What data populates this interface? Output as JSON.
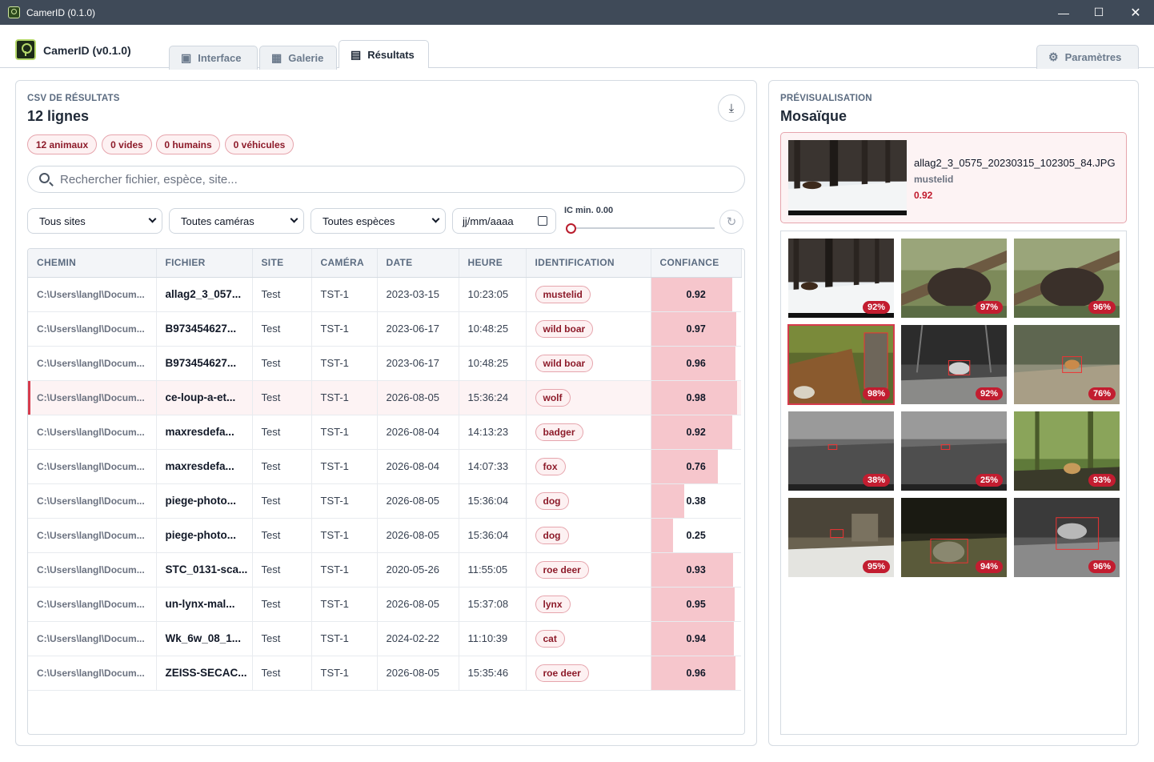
{
  "window": {
    "title": "CamerID (0.1.0)",
    "controls": [
      "minimize",
      "maximize",
      "close"
    ]
  },
  "header": {
    "brand": "CamerID (v0.1.0)",
    "tabs": [
      {
        "label": "Interface",
        "icon": "image-search-icon",
        "active": false
      },
      {
        "label": "Galerie",
        "icon": "gallery-icon",
        "active": false
      },
      {
        "label": "Résultats",
        "icon": "document-icon",
        "active": true
      }
    ],
    "settings_label": "Paramètres"
  },
  "results": {
    "kicker": "CSV DE RÉSULTATS",
    "title": "12 lignes",
    "pills": [
      "12 animaux",
      "0 vides",
      "0 humains",
      "0 véhicules"
    ],
    "search_placeholder": "Rechercher fichier, espèce, site...",
    "filters": {
      "site": "Tous sites",
      "camera": "Toutes caméras",
      "species": "Toutes espèces",
      "date_placeholder": "jj/mm/aaaa",
      "ic_label": "IC min. 0.00",
      "ic_min": 0.0
    },
    "columns": [
      "CHEMIN",
      "FICHIER",
      "SITE",
      "CAMÉRA",
      "DATE",
      "HEURE",
      "IDENTIFICATION",
      "CONFIANCE"
    ],
    "rows": [
      {
        "path": "C:\\Users\\langl\\Docum...",
        "file": "allag2_3_057...",
        "site": "Test",
        "camera": "TST-1",
        "date": "2023-03-15",
        "time": "10:23:05",
        "id": "mustelid",
        "conf": "0.92",
        "selected": false
      },
      {
        "path": "C:\\Users\\langl\\Docum...",
        "file": "B973454627...",
        "site": "Test",
        "camera": "TST-1",
        "date": "2023-06-17",
        "time": "10:48:25",
        "id": "wild boar",
        "conf": "0.97",
        "selected": false
      },
      {
        "path": "C:\\Users\\langl\\Docum...",
        "file": "B973454627...",
        "site": "Test",
        "camera": "TST-1",
        "date": "2023-06-17",
        "time": "10:48:25",
        "id": "wild boar",
        "conf": "0.96",
        "selected": false
      },
      {
        "path": "C:\\Users\\langl\\Docum...",
        "file": "ce-loup-a-et...",
        "site": "Test",
        "camera": "TST-1",
        "date": "2026-08-05",
        "time": "15:36:24",
        "id": "wolf",
        "conf": "0.98",
        "selected": true
      },
      {
        "path": "C:\\Users\\langl\\Docum...",
        "file": "maxresdefa...",
        "site": "Test",
        "camera": "TST-1",
        "date": "2026-08-04",
        "time": "14:13:23",
        "id": "badger",
        "conf": "0.92",
        "selected": false
      },
      {
        "path": "C:\\Users\\langl\\Docum...",
        "file": "maxresdefa...",
        "site": "Test",
        "camera": "TST-1",
        "date": "2026-08-04",
        "time": "14:07:33",
        "id": "fox",
        "conf": "0.76",
        "selected": false
      },
      {
        "path": "C:\\Users\\langl\\Docum...",
        "file": "piege-photo...",
        "site": "Test",
        "camera": "TST-1",
        "date": "2026-08-05",
        "time": "15:36:04",
        "id": "dog",
        "conf": "0.38",
        "selected": false
      },
      {
        "path": "C:\\Users\\langl\\Docum...",
        "file": "piege-photo...",
        "site": "Test",
        "camera": "TST-1",
        "date": "2026-08-05",
        "time": "15:36:04",
        "id": "dog",
        "conf": "0.25",
        "selected": false
      },
      {
        "path": "C:\\Users\\langl\\Docum...",
        "file": "STC_0131-sca...",
        "site": "Test",
        "camera": "TST-1",
        "date": "2020-05-26",
        "time": "11:55:05",
        "id": "roe deer",
        "conf": "0.93",
        "selected": false
      },
      {
        "path": "C:\\Users\\langl\\Docum...",
        "file": "un-lynx-mal...",
        "site": "Test",
        "camera": "TST-1",
        "date": "2026-08-05",
        "time": "15:37:08",
        "id": "lynx",
        "conf": "0.95",
        "selected": false
      },
      {
        "path": "C:\\Users\\langl\\Docum...",
        "file": "Wk_6w_08_1...",
        "site": "Test",
        "camera": "TST-1",
        "date": "2024-02-22",
        "time": "11:10:39",
        "id": "cat",
        "conf": "0.94",
        "selected": false
      },
      {
        "path": "C:\\Users\\langl\\Docum...",
        "file": "ZEISS-SECAC...",
        "site": "Test",
        "camera": "TST-1",
        "date": "2026-08-05",
        "time": "15:35:46",
        "id": "roe deer",
        "conf": "0.96",
        "selected": false
      }
    ]
  },
  "preview": {
    "kicker": "PRÉVISUALISATION",
    "title": "Mosaïque",
    "featured": {
      "filename": "allag2_3_0575_20230315_102305_84.JPG",
      "species": "mustelid",
      "confidence": "0.92"
    },
    "tiles": [
      {
        "badge": "92%",
        "scene": "snow-forest",
        "selected": false
      },
      {
        "badge": "97%",
        "scene": "boar-log",
        "selected": false
      },
      {
        "badge": "96%",
        "scene": "boar-log",
        "selected": false
      },
      {
        "badge": "98%",
        "scene": "wolf",
        "selected": true
      },
      {
        "badge": "92%",
        "scene": "night-badger",
        "selected": false
      },
      {
        "badge": "76%",
        "scene": "fox-forest",
        "selected": false
      },
      {
        "badge": "38%",
        "scene": "night-field",
        "selected": false
      },
      {
        "badge": "25%",
        "scene": "night-field",
        "selected": false
      },
      {
        "badge": "93%",
        "scene": "green-forest",
        "selected": false
      },
      {
        "badge": "95%",
        "scene": "rock-snow",
        "selected": false
      },
      {
        "badge": "94%",
        "scene": "lynx-night",
        "selected": false
      },
      {
        "badge": "96%",
        "scene": "deer-night",
        "selected": false
      }
    ]
  },
  "colors": {
    "accent": "#c21d30",
    "pill_border": "#e6a5ad",
    "conf_bar": "#f6c6cc",
    "titlebar": "#3f4a58"
  }
}
